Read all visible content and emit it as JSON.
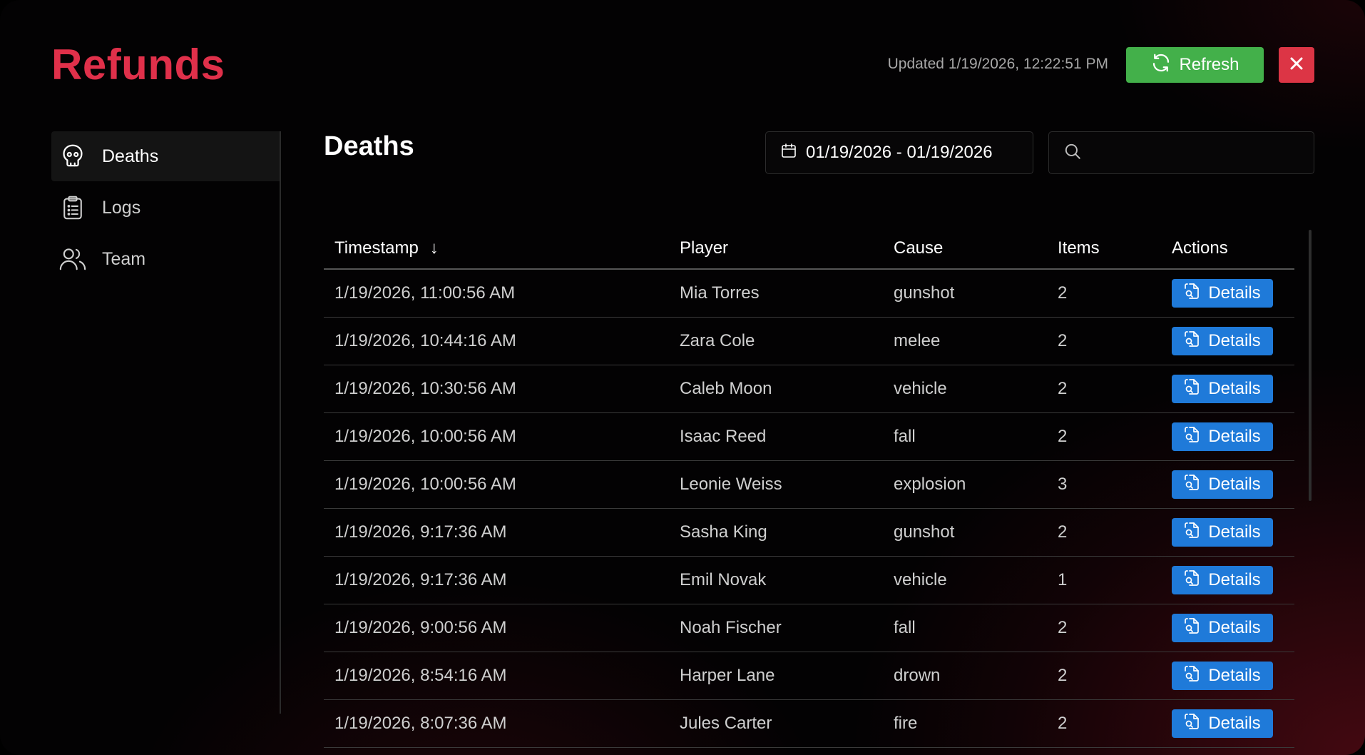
{
  "app": {
    "logo": "Refunds"
  },
  "header": {
    "updated_text": "Updated 1/19/2026, 12:22:51 PM",
    "refresh_label": "Refresh"
  },
  "sidebar": {
    "items": [
      {
        "label": "Deaths",
        "icon": "skull-icon",
        "active": true
      },
      {
        "label": "Logs",
        "icon": "clipboard-list-icon",
        "active": false
      },
      {
        "label": "Team",
        "icon": "users-icon",
        "active": false
      }
    ]
  },
  "main": {
    "title": "Deaths",
    "date_range": "01/19/2026 - 01/19/2026",
    "search": {
      "value": "",
      "placeholder": ""
    }
  },
  "table": {
    "columns": [
      "Timestamp",
      "Player",
      "Cause",
      "Items",
      "Actions"
    ],
    "sort_indicator": "↓",
    "action_label": "Details",
    "rows": [
      {
        "timestamp": "1/19/2026, 11:00:56 AM",
        "player": "Mia Torres",
        "cause": "gunshot",
        "items": "2"
      },
      {
        "timestamp": "1/19/2026, 10:44:16 AM",
        "player": "Zara Cole",
        "cause": "melee",
        "items": "2"
      },
      {
        "timestamp": "1/19/2026, 10:30:56 AM",
        "player": "Caleb Moon",
        "cause": "vehicle",
        "items": "2"
      },
      {
        "timestamp": "1/19/2026, 10:00:56 AM",
        "player": "Isaac Reed",
        "cause": "fall",
        "items": "2"
      },
      {
        "timestamp": "1/19/2026, 10:00:56 AM",
        "player": "Leonie Weiss",
        "cause": "explosion",
        "items": "3"
      },
      {
        "timestamp": "1/19/2026, 9:17:36 AM",
        "player": "Sasha King",
        "cause": "gunshot",
        "items": "2"
      },
      {
        "timestamp": "1/19/2026, 9:17:36 AM",
        "player": "Emil Novak",
        "cause": "vehicle",
        "items": "1"
      },
      {
        "timestamp": "1/19/2026, 9:00:56 AM",
        "player": "Noah Fischer",
        "cause": "fall",
        "items": "2"
      },
      {
        "timestamp": "1/19/2026, 8:54:16 AM",
        "player": "Harper Lane",
        "cause": "drown",
        "items": "2"
      },
      {
        "timestamp": "1/19/2026, 8:07:36 AM",
        "player": "Jules Carter",
        "cause": "fire",
        "items": "2"
      }
    ]
  },
  "colors": {
    "brand": "#e0304a",
    "refresh": "#43b04a",
    "close": "#dc3545",
    "details": "#1f7ad9"
  }
}
